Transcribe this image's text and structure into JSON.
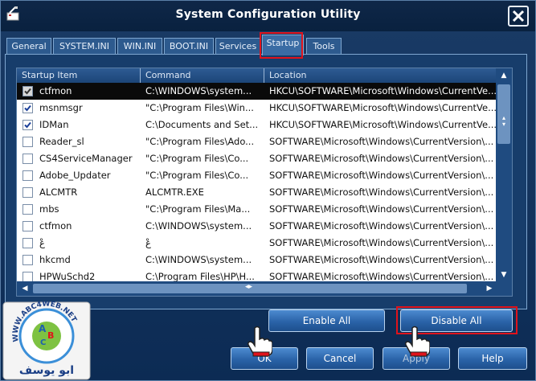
{
  "window": {
    "title": "System Configuration Utility"
  },
  "tabs": [
    {
      "label": "General"
    },
    {
      "label": "SYSTEM.INI"
    },
    {
      "label": "WIN.INI"
    },
    {
      "label": "BOOT.INI"
    },
    {
      "label": "Services"
    },
    {
      "label": "Startup",
      "active": true
    },
    {
      "label": "Tools"
    }
  ],
  "startup": {
    "columns": [
      "Startup Item",
      "Command",
      "Location"
    ],
    "rows": [
      {
        "checked": true,
        "selected": true,
        "item": "ctfmon",
        "command": "C:\\WINDOWS\\system...",
        "location": "HKCU\\SOFTWARE\\Microsoft\\Windows\\CurrentVe..."
      },
      {
        "checked": true,
        "selected": false,
        "item": "msnmsgr",
        "command": "\"C:\\Program Files\\Win...",
        "location": "HKCU\\SOFTWARE\\Microsoft\\Windows\\CurrentVe..."
      },
      {
        "checked": true,
        "selected": false,
        "item": "IDMan",
        "command": "C:\\Documents and Set...",
        "location": "HKCU\\SOFTWARE\\Microsoft\\Windows\\CurrentVe..."
      },
      {
        "checked": false,
        "selected": false,
        "item": "Reader_sl",
        "command": "\"C:\\Program Files\\Ado...",
        "location": "SOFTWARE\\Microsoft\\Windows\\CurrentVersion\\..."
      },
      {
        "checked": false,
        "selected": false,
        "item": "CS4ServiceManager",
        "command": "\"C:\\Program Files\\Co...",
        "location": "SOFTWARE\\Microsoft\\Windows\\CurrentVersion\\..."
      },
      {
        "checked": false,
        "selected": false,
        "item": "Adobe_Updater",
        "command": "\"C:\\Program Files\\Co...",
        "location": "SOFTWARE\\Microsoft\\Windows\\CurrentVersion\\..."
      },
      {
        "checked": false,
        "selected": false,
        "item": "ALCMTR",
        "command": "ALCMTR.EXE",
        "location": "SOFTWARE\\Microsoft\\Windows\\CurrentVersion\\..."
      },
      {
        "checked": false,
        "selected": false,
        "item": "mbs",
        "command": "\"C:\\Program Files\\Ma...",
        "location": "SOFTWARE\\Microsoft\\Windows\\CurrentVersion\\..."
      },
      {
        "checked": false,
        "selected": false,
        "item": "ctfmon",
        "command": "C:\\WINDOWS\\system...",
        "location": "SOFTWARE\\Microsoft\\Windows\\CurrentVersion\\..."
      },
      {
        "checked": false,
        "selected": false,
        "item": "عْ",
        "command": "عْ",
        "location": "SOFTWARE\\Microsoft\\Windows\\CurrentVersion\\..."
      },
      {
        "checked": false,
        "selected": false,
        "item": "hkcmd",
        "command": "C:\\WINDOWS\\system...",
        "location": "SOFTWARE\\Microsoft\\Windows\\CurrentVersion\\..."
      },
      {
        "checked": false,
        "selected": false,
        "item": "HPWuSchd2",
        "command": "C:\\Program Files\\HP\\H...",
        "location": "SOFTWARE\\Microsoft\\Windows\\CurrentVersion\\..."
      }
    ],
    "enable_all_label": "Enable All",
    "disable_all_label": "Disable All"
  },
  "footer": {
    "ok_label": "OK",
    "cancel_label": "Cancel",
    "apply_label": "Apply",
    "help_label": "Help"
  },
  "watermark": {
    "text": "WWW.ABC4WEB.NET",
    "arabic": "ابو يوسف"
  },
  "colors": {
    "highlight_red": "#e0131b",
    "window_blue": "#0c2b54",
    "selected_row": "#0a0a0a"
  },
  "icons": [
    "app-icon",
    "close-icon",
    "checkbox-icon",
    "scroll-up-icon",
    "scroll-down-icon",
    "scroll-left-icon",
    "scroll-right-icon",
    "pointer-hand-icon"
  ]
}
